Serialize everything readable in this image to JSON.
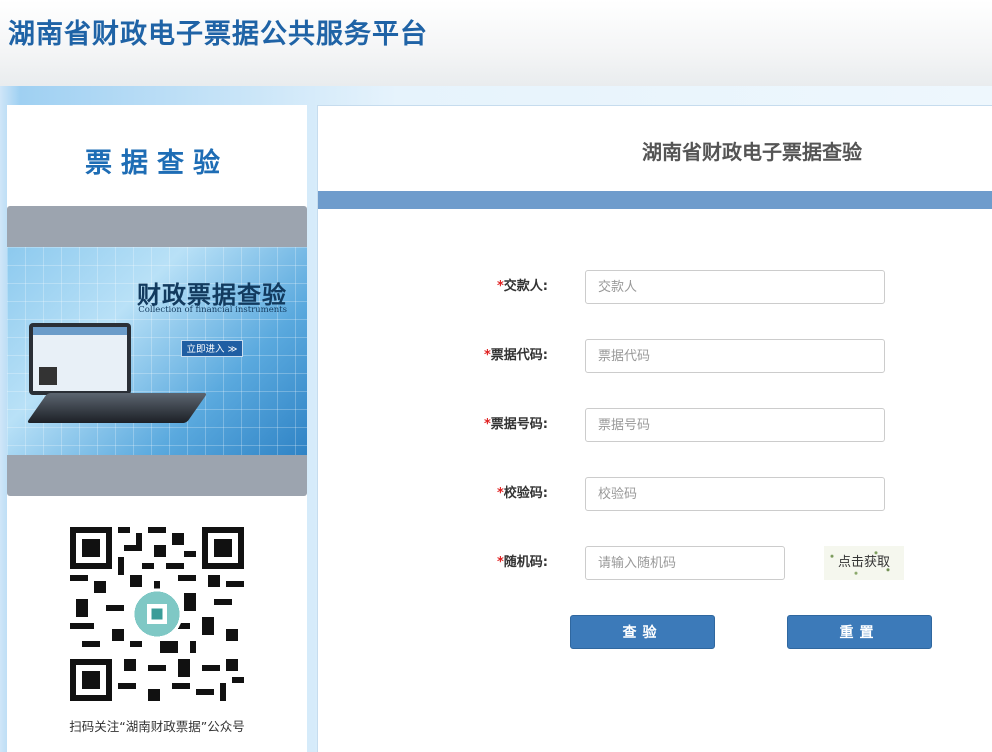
{
  "header": {
    "site_title": "湖南省财政电子票据公共服务平台"
  },
  "sidebar": {
    "title": "票据查验",
    "banner": {
      "heading": "财政票据查验",
      "subheading": "Collection of financial instruments",
      "enter_label": "立即进入 ≫"
    },
    "qr_caption": "扫码关注“湖南财政票据”公众号"
  },
  "main": {
    "title": "湖南省财政电子票据查验",
    "form": {
      "fields": [
        {
          "label": "交款人:",
          "placeholder": "交款人",
          "value": ""
        },
        {
          "label": "票据代码:",
          "placeholder": "票据代码",
          "value": ""
        },
        {
          "label": "票据号码:",
          "placeholder": "票据号码",
          "value": ""
        },
        {
          "label": "校验码:",
          "placeholder": "校验码",
          "value": ""
        },
        {
          "label": "随机码:",
          "placeholder": "请输入随机码",
          "value": ""
        }
      ],
      "required_mark": "*",
      "captcha_label": "点击获取",
      "submit_label": "查验",
      "reset_label": "重置"
    }
  },
  "colors": {
    "brand_blue": "#1f63a6",
    "bar_blue": "#6f9ccc",
    "button_blue": "#3c7ab9",
    "required_red": "#e02020"
  }
}
